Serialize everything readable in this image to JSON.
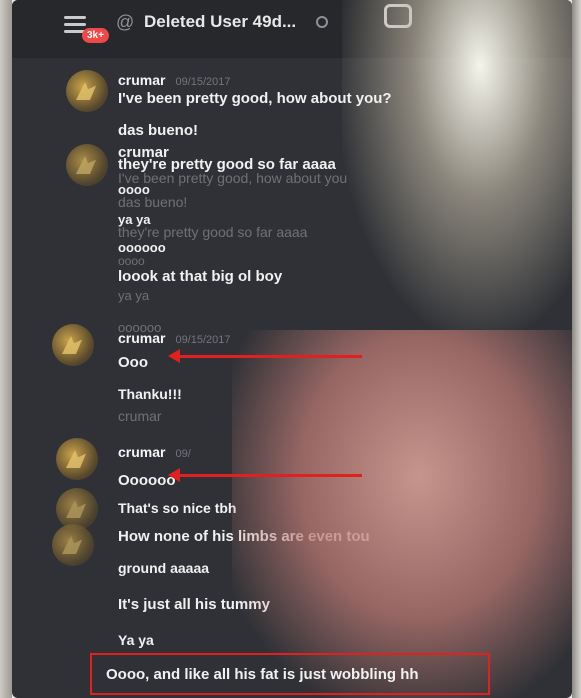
{
  "header": {
    "badge": "3k+",
    "channel_title": "Deleted User 49d...",
    "at_symbol": "@"
  },
  "messages": {
    "m1_name": "crumar",
    "m1_date": "09/15/2017",
    "m1_text": "I've been pretty good, how about you?",
    "m2_text": "das bueno!",
    "m3_name": "crumar",
    "m3_text": "they're pretty good so far aaaa",
    "m3_ghost": "I've been pretty good, how about you",
    "m4_text": "oooo",
    "m4_ghost": "das bueno!",
    "m5_text": "ya ya",
    "m5_ghost": "they're pretty good so far aaaa",
    "m6_text": "oooooo",
    "m6_ghost": "oooo",
    "m7_text": "loook at that big ol boy",
    "m7_ghost": "ya ya",
    "m8_ghost": "oooooo",
    "m8_name": "crumar",
    "m8_date": "09/15/2017",
    "m9_text": "Ooo",
    "m10_text": "Thanku!!!",
    "m11_ghost": "crumar",
    "m12_name": "crumar",
    "m12_date": "09/",
    "m13_text": "Oooooo",
    "m14_text": "That's so nice tbh",
    "m15_text": "How none of his limbs are even tou",
    "m16_text": "ground aaaaa",
    "m17_text": "It's just all his tummy",
    "m18_text": "Ya ya",
    "m19_text": "Oooo, and like all his fat is just wobbling hh"
  },
  "annotations": {
    "arrow_color": "#e0211f"
  }
}
